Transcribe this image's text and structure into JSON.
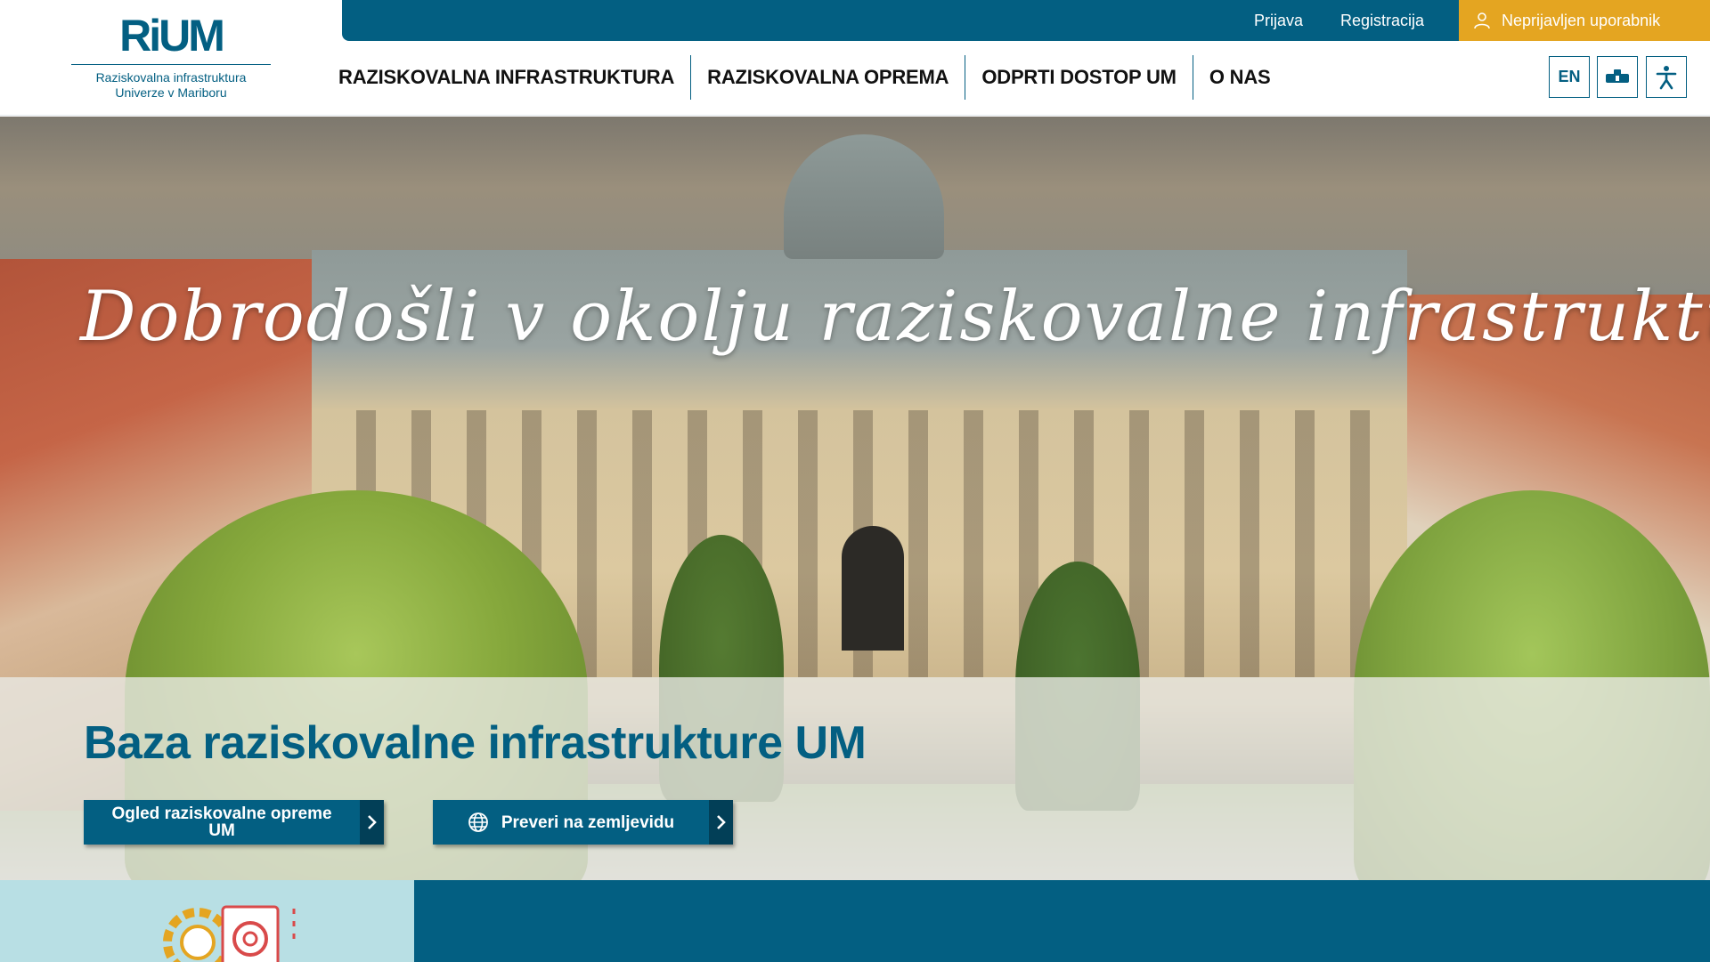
{
  "logo": {
    "mark": "RiUM",
    "line1": "Raziskovalna infrastruktura",
    "line2": "Univerze v Mariboru"
  },
  "topbar": {
    "login": "Prijava",
    "register": "Registracija",
    "user_status": "Neprijavljen uporabnik",
    "user_icon": "user-icon"
  },
  "nav": {
    "items": [
      "RAZISKOVALNA INFRASTRUKTURA",
      "RAZISKOVALNA OPREMA",
      "ODPRTI DOSTOP UM",
      "O NAS"
    ]
  },
  "utility": {
    "language": "EN",
    "sign_language_icon": "sign-language-icon",
    "accessibility_icon": "accessibility-icon"
  },
  "hero": {
    "welcome": "Dobrodošli v okolju raziskovalne infrastrukture UM!",
    "panel_title": "Baza raziskovalne infrastrukture UM",
    "cta_equipment": "Ogled raziskovalne opreme UM",
    "cta_map": "Preveri na zemljevidu",
    "map_icon": "globe-icon",
    "arrow_icon": "chevron-right-icon"
  },
  "colors": {
    "primary": "#035f82",
    "accent": "#e4a521",
    "panel_light": "#b8dfe4"
  }
}
